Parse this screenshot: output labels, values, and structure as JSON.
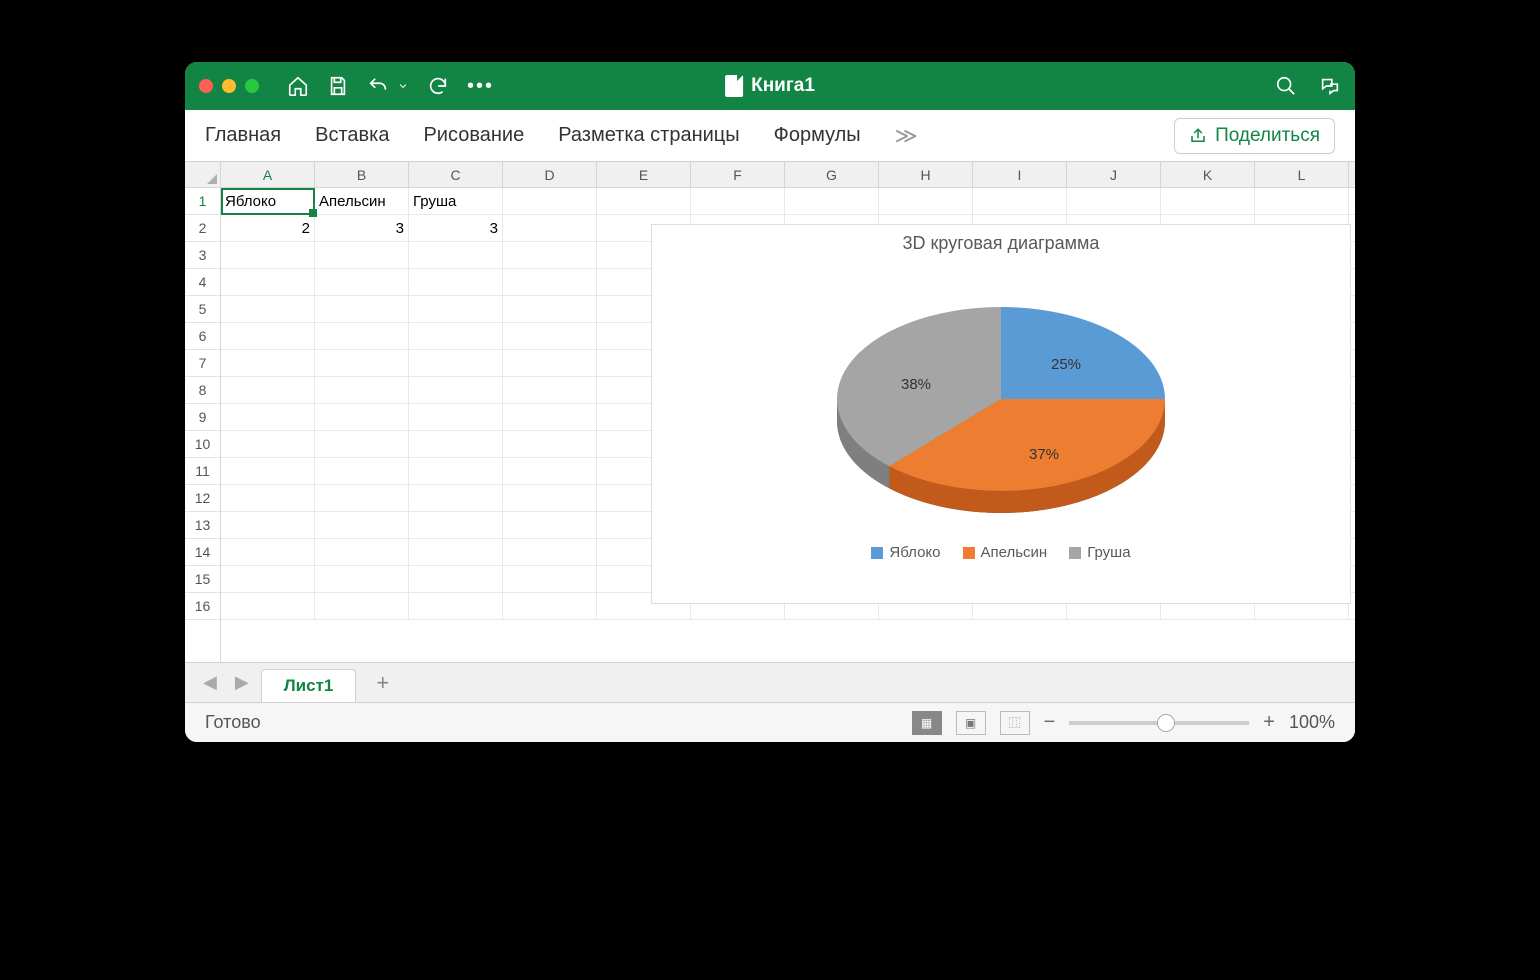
{
  "window": {
    "title": "Книга1"
  },
  "ribbon": {
    "tabs": [
      "Главная",
      "Вставка",
      "Рисование",
      "Разметка страницы",
      "Формулы"
    ],
    "more": "≫",
    "share": "Поделиться"
  },
  "columns": [
    "A",
    "B",
    "C",
    "D",
    "E",
    "F",
    "G",
    "H",
    "I",
    "J",
    "K",
    "L"
  ],
  "rows": [
    "1",
    "2",
    "3",
    "4",
    "5",
    "6",
    "7",
    "8",
    "9",
    "10",
    "11",
    "12",
    "13",
    "14",
    "15",
    "16"
  ],
  "data": {
    "r0": {
      "c0": "Яблоко",
      "c1": "Апельсин",
      "c2": "Груша"
    },
    "r1": {
      "c0": "2",
      "c1": "3",
      "c2": "3"
    }
  },
  "active": {
    "col": 0,
    "row": 0
  },
  "chart_data": {
    "type": "pie",
    "title": "3D круговая диаграмма",
    "series": [
      {
        "name": "Яблоко",
        "value": 2,
        "percent_label": "25%",
        "color": "#5b9bd5"
      },
      {
        "name": "Апельсин",
        "value": 3,
        "percent_label": "37%",
        "color": "#ed7d31"
      },
      {
        "name": "Груша",
        "value": 3,
        "percent_label": "38%",
        "color": "#a5a5a5"
      }
    ]
  },
  "sheet": {
    "name": "Лист1",
    "add": "+"
  },
  "status": {
    "ready": "Готово",
    "zoom": "100%",
    "minus": "−",
    "plus": "+"
  }
}
